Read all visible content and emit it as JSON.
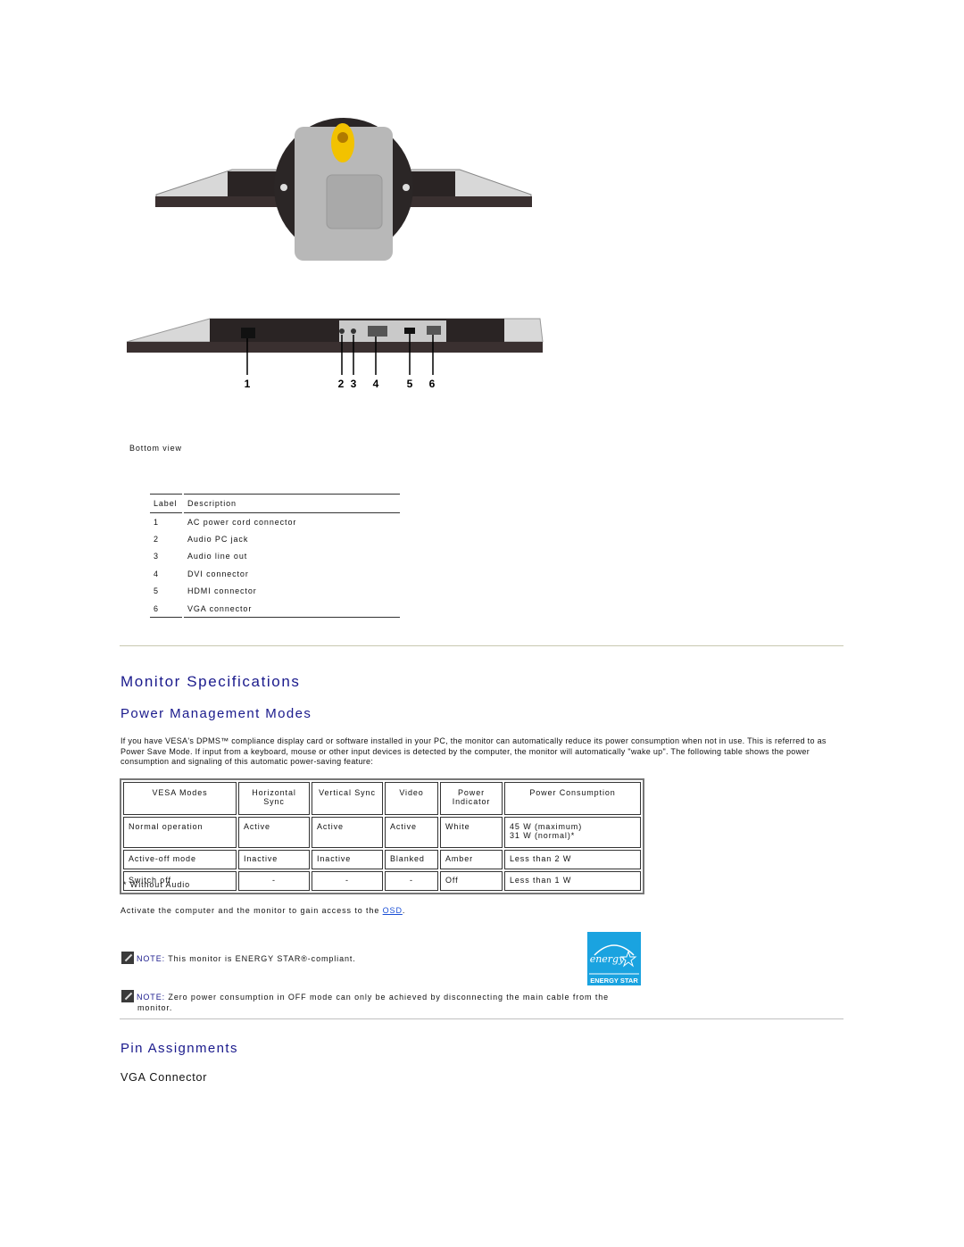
{
  "figures": {
    "top_view_alt": "Monitor bottom view with stand",
    "bottom_view_alt": "Monitor bottom connectors",
    "callouts": [
      "1",
      "2",
      "3",
      "4",
      "5",
      "6"
    ],
    "caption": "Bottom view"
  },
  "label_table": {
    "headers": [
      "Label",
      "Description"
    ],
    "rows": [
      [
        "1",
        "AC power cord connector"
      ],
      [
        "2",
        "Audio PC jack"
      ],
      [
        "3",
        "Audio line out"
      ],
      [
        "4",
        "DVI connector"
      ],
      [
        "5",
        "HDMI connector"
      ],
      [
        "6",
        "VGA connector"
      ]
    ]
  },
  "section": {
    "title": "Monitor Specifications",
    "subtitle": "Power Management Modes",
    "paragraph": "If you have VESA's DPMS™ compliance display card or software installed in your PC, the monitor can automatically reduce its power consumption when not in use. This is referred to as Power Save Mode. If input from a keyboard, mouse or other input devices is detected by the computer, the monitor will automatically \"wake up\". The following table shows the power consumption and signaling of this automatic power-saving feature:"
  },
  "power_table": {
    "headers": [
      "VESA Modes",
      "Horizontal Sync",
      "Vertical Sync",
      "Video",
      "Power Indicator",
      "Power Consumption"
    ],
    "rows": [
      [
        "Normal operation",
        "Active",
        "Active",
        "Active",
        "White",
        "45 W (maximum)",
        "31 W (normal)*"
      ],
      [
        "Active-off mode",
        "Inactive",
        "Inactive",
        "Blanked",
        "Amber",
        "Less than 2 W"
      ],
      [
        "Switch off",
        "-",
        "-",
        "-",
        "Off",
        "Less than 1 W"
      ]
    ],
    "footnote": "* Without Audio"
  },
  "activate": {
    "text": "Activate the computer and the monitor to gain access to the ",
    "link": "OSD",
    "suffix": "."
  },
  "notes": [
    {
      "keyword": "NOTE:",
      "text": " This monitor is ENERGY STAR®-compliant."
    },
    {
      "keyword": "NOTE:",
      "text": " Zero power consumption in OFF mode can only be achieved by disconnecting the main cable from the",
      "cont": "monitor."
    }
  ],
  "energy_star": {
    "label": "ENERGY STAR",
    "script": "energy",
    "color": "#1aa3e0"
  },
  "pin_section": {
    "title": "Pin Assignments",
    "subtitle": "VGA Connector"
  },
  "colors": {
    "heading": "#1a1a8c",
    "link": "#1a4fd6"
  }
}
